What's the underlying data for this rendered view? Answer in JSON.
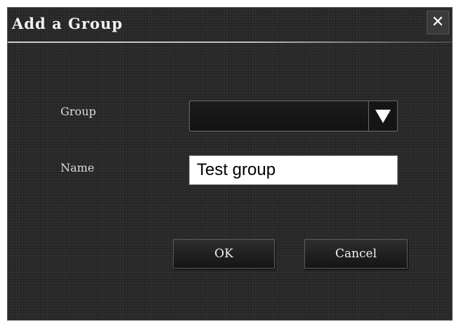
{
  "dialog": {
    "title": "Add a Group",
    "close_icon": "close-icon",
    "close_glyph": "✕"
  },
  "form": {
    "group_label": "Group",
    "group_value": "",
    "name_label": "Name",
    "name_value": "Test group"
  },
  "buttons": {
    "ok_label": "OK",
    "cancel_label": "Cancel"
  },
  "colors": {
    "background": "#262626",
    "text": "#f2f2f2",
    "input_background": "#ffffff"
  }
}
